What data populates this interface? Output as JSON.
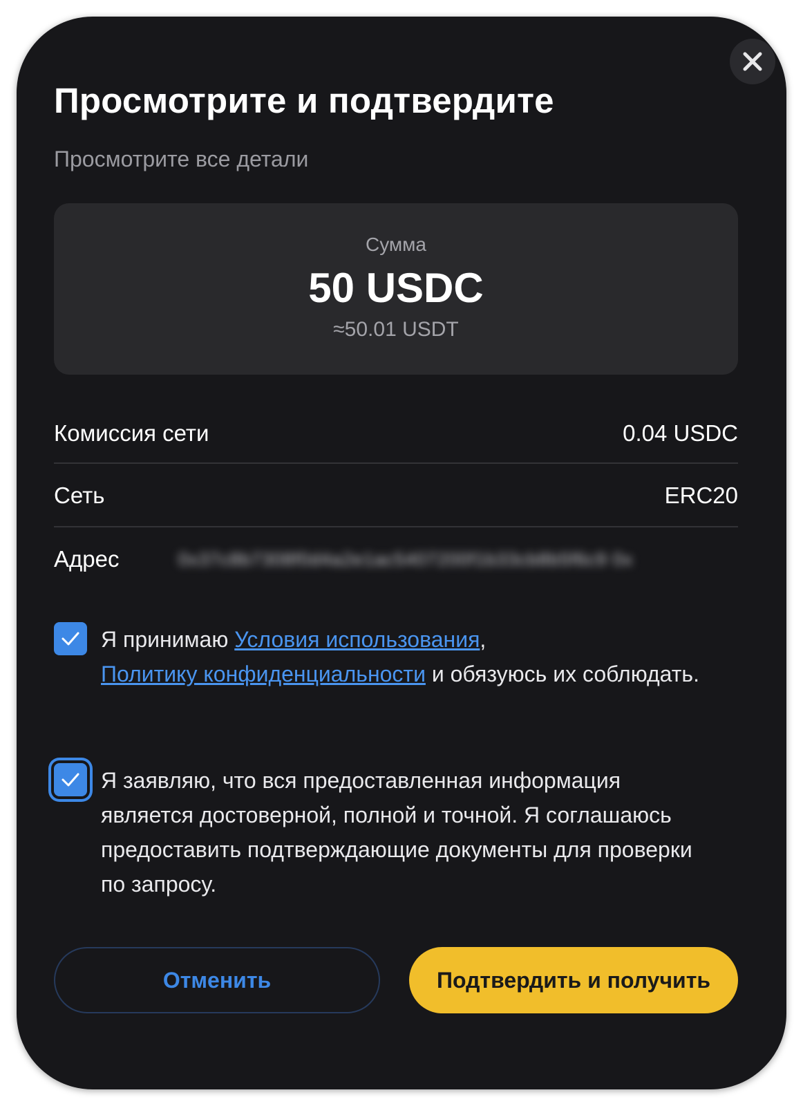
{
  "dialog": {
    "title": "Просмотрите и подтвердите",
    "subtitle": "Просмотрите все детали"
  },
  "amount": {
    "label": "Сумма",
    "value": "50 USDC",
    "approx": "≈50.01 USDT"
  },
  "details": [
    {
      "label": "Комиссия сети",
      "value": "0.04 USDC"
    },
    {
      "label": "Сеть",
      "value": "ERC20"
    },
    {
      "label": "Адрес",
      "value": "(blurred address)"
    }
  ],
  "consents": {
    "terms": {
      "checked": true,
      "prefix": "Я принимаю ",
      "terms_link": "Условия использования",
      "comma": ",",
      "privacy_link": "Политику конфиденциальности",
      "suffix": " и обязуюсь их соблюдать."
    },
    "declaration": {
      "checked": true,
      "text": "Я заявляю, что вся предоставленная информация является достоверной, полной и точной. Я соглашаюсь предоставить подтверждающие документы для проверки по запросу."
    }
  },
  "buttons": {
    "cancel": "Отменить",
    "confirm": "Подтвердить и получить"
  },
  "colors": {
    "background": "#17171a",
    "card": "#29292c",
    "accent_blue": "#3d88e6",
    "link_blue": "#4a95f0",
    "confirm_yellow": "#f1be2b"
  }
}
